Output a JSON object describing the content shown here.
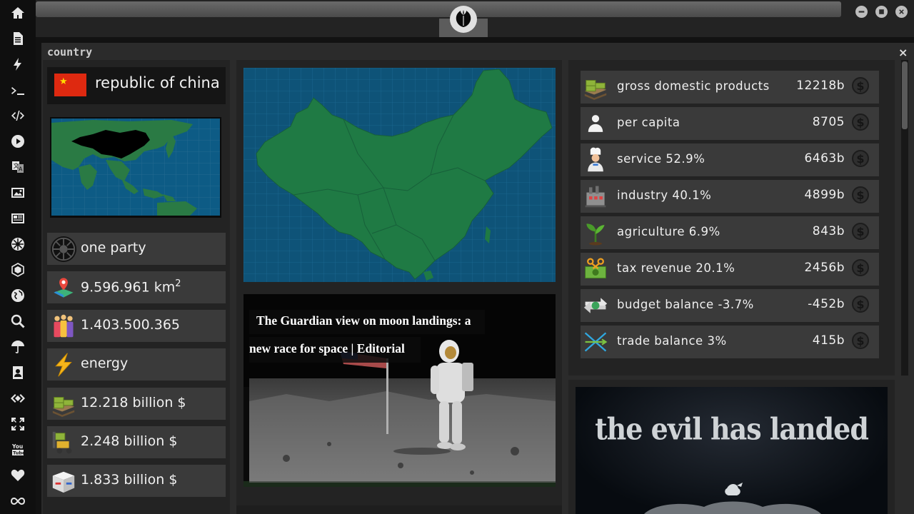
{
  "window": {
    "title": "country",
    "close": "×"
  },
  "country": {
    "name": "republic of china",
    "flag_star": "★"
  },
  "sidebar": {
    "icons": [
      "home-icon",
      "document-icon",
      "bolt-icon",
      "terminal-icon",
      "code-icon",
      "play-icon",
      "translate-icon",
      "image-icon",
      "news-icon",
      "empire-icon",
      "hexagon-icon",
      "globe-icon",
      "search-icon",
      "umbrella-icon",
      "contact-icon",
      "diamond-code-icon",
      "fullscreen-icon",
      "youtube-icon",
      "heart-icon",
      "infinity-icon"
    ]
  },
  "left_stats": [
    {
      "icon": "empire-icon",
      "label": "one party"
    },
    {
      "icon": "map-pin-icon",
      "label": "9.596.961 km",
      "sup": "2"
    },
    {
      "icon": "population-icon",
      "label": "1.403.500.365"
    },
    {
      "icon": "energy-icon",
      "label": "energy"
    },
    {
      "icon": "money-stack-icon",
      "label": "12.218 billion $"
    },
    {
      "icon": "forklift-money-icon",
      "label": "2.248 billion $"
    },
    {
      "icon": "boxes-icon",
      "label": "1.833 billion $"
    }
  ],
  "news": {
    "headline_line1": "The Guardian view on moon landings: a",
    "headline_line2": "new race for space | Editorial"
  },
  "economy": [
    {
      "icon": "money-stack-icon",
      "label": "gross domestic products",
      "value": "12218b"
    },
    {
      "icon": "person-icon",
      "label": "per capita",
      "value": "8705"
    },
    {
      "icon": "chef-icon",
      "label": "service 52.9%",
      "value": "6463b"
    },
    {
      "icon": "factory-icon",
      "label": "industry 40.1%",
      "value": "4899b"
    },
    {
      "icon": "sprout-icon",
      "label": "agriculture 6.9%",
      "value": "843b"
    },
    {
      "icon": "tax-icon",
      "label": "tax revenue 20.1%",
      "value": "2456b"
    },
    {
      "icon": "budget-arrows-icon",
      "label": "budget balance -3.7%",
      "value": "-452b"
    },
    {
      "icon": "trade-icon",
      "label": "trade balance 3%",
      "value": "415b"
    }
  ],
  "coin_symbol": "$",
  "promo": {
    "title": "the evil has landed"
  }
}
